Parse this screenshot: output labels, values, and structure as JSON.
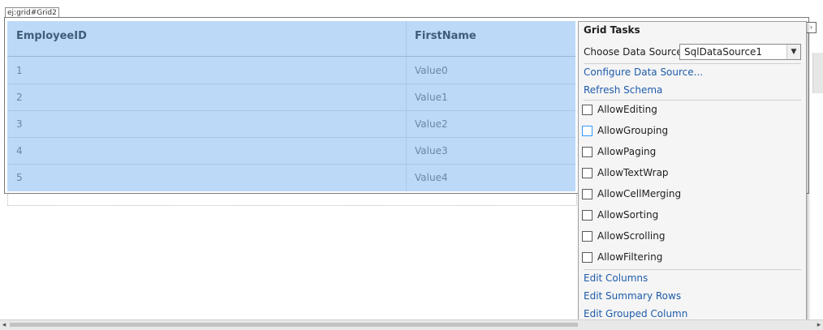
{
  "designer": {
    "control_tag": "ej:grid#Grid2"
  },
  "grid": {
    "columns": [
      "EmployeeID",
      "FirstName"
    ],
    "rows": [
      [
        "1",
        "Value0"
      ],
      [
        "2",
        "Value1"
      ],
      [
        "3",
        "Value2"
      ],
      [
        "4",
        "Value3"
      ],
      [
        "5",
        "Value4"
      ]
    ]
  },
  "tasks_panel": {
    "title": "Grid Tasks",
    "data_source_label": "Choose Data Source:",
    "data_source_value": "SqlDataSource1",
    "links_top": [
      "Configure Data Source...",
      "Refresh Schema"
    ],
    "options": [
      {
        "label": "AllowEditing",
        "checked": false
      },
      {
        "label": "AllowGrouping",
        "checked": false
      },
      {
        "label": "AllowPaging",
        "checked": false
      },
      {
        "label": "AllowTextWrap",
        "checked": false
      },
      {
        "label": "AllowCellMerging",
        "checked": false
      },
      {
        "label": "AllowSorting",
        "checked": false
      },
      {
        "label": "AllowScrolling",
        "checked": false
      },
      {
        "label": "AllowFiltering",
        "checked": false
      }
    ],
    "links_bottom": [
      "Edit Columns",
      "Edit Summary Rows",
      "Edit Grouped Column"
    ]
  },
  "icons": {
    "smart_tag": "chevron-right-icon",
    "dropdown": "chevron-down-icon",
    "scroll_left": "scroll-left-arrow-icon",
    "scroll_right": "scroll-right-arrow-icon"
  },
  "colors": {
    "grid_bg": "#bcd9f8",
    "header_text": "#3f5d79",
    "cell_text": "#6b87a5",
    "link": "#1e5bab",
    "panel_bg": "#f5f5f5"
  }
}
